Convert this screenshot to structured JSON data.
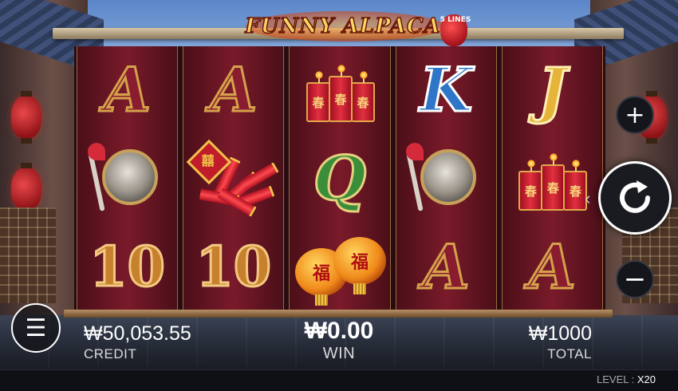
{
  "logo": {
    "title": "FUNNY ALPACA",
    "lines_badge": "5 LINES"
  },
  "reels": [
    [
      "A",
      "gong",
      "10"
    ],
    [
      "A",
      "firecracker-bundle",
      "10"
    ],
    [
      "firecrackers",
      "Q",
      "lanterns"
    ],
    [
      "K",
      "gong",
      "A"
    ],
    [
      "J",
      "firecrackers",
      "A"
    ]
  ],
  "symbol_text": {
    "firecracker_glyph": "春",
    "bundle_glyph": "囍",
    "lantern_glyph": "福"
  },
  "controls": {
    "plus": "+",
    "minus": "−",
    "spin": "spin",
    "menu": "☰",
    "spin_hint": "‹"
  },
  "stats": {
    "credit_value": "₩50,053.55",
    "credit_label": "CREDIT",
    "win_value": "₩0.00",
    "win_label": "WIN",
    "total_value": "₩1000",
    "total_label": "TOTAL"
  },
  "level": {
    "label": "LEVEL :",
    "value": "X20"
  },
  "colors": {
    "reel_bg": "#7a1a2a",
    "gold": "#d4a24a",
    "letter_A": "#8a1c30",
    "letter_K": "#2f76c8",
    "letter_J": "#e6b43a",
    "letter_Q": "#3a8e3a",
    "number_10": "#c7812e"
  }
}
